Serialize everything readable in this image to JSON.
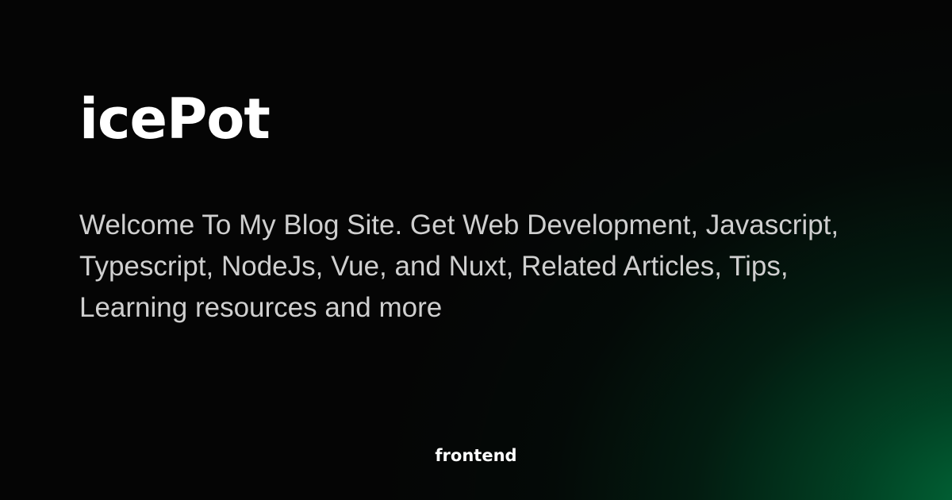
{
  "card": {
    "title": "icePot",
    "description": "Welcome To My Blog Site. Get Web Development, Javascript, Typescript, NodeJs, Vue, and Nuxt, Related Articles, Tips, Learning resources and more",
    "tag": "frontend"
  },
  "colors": {
    "background": "#050505",
    "glow": "#006c3a",
    "title": "#ffffff",
    "description": "#cfcfcf"
  }
}
